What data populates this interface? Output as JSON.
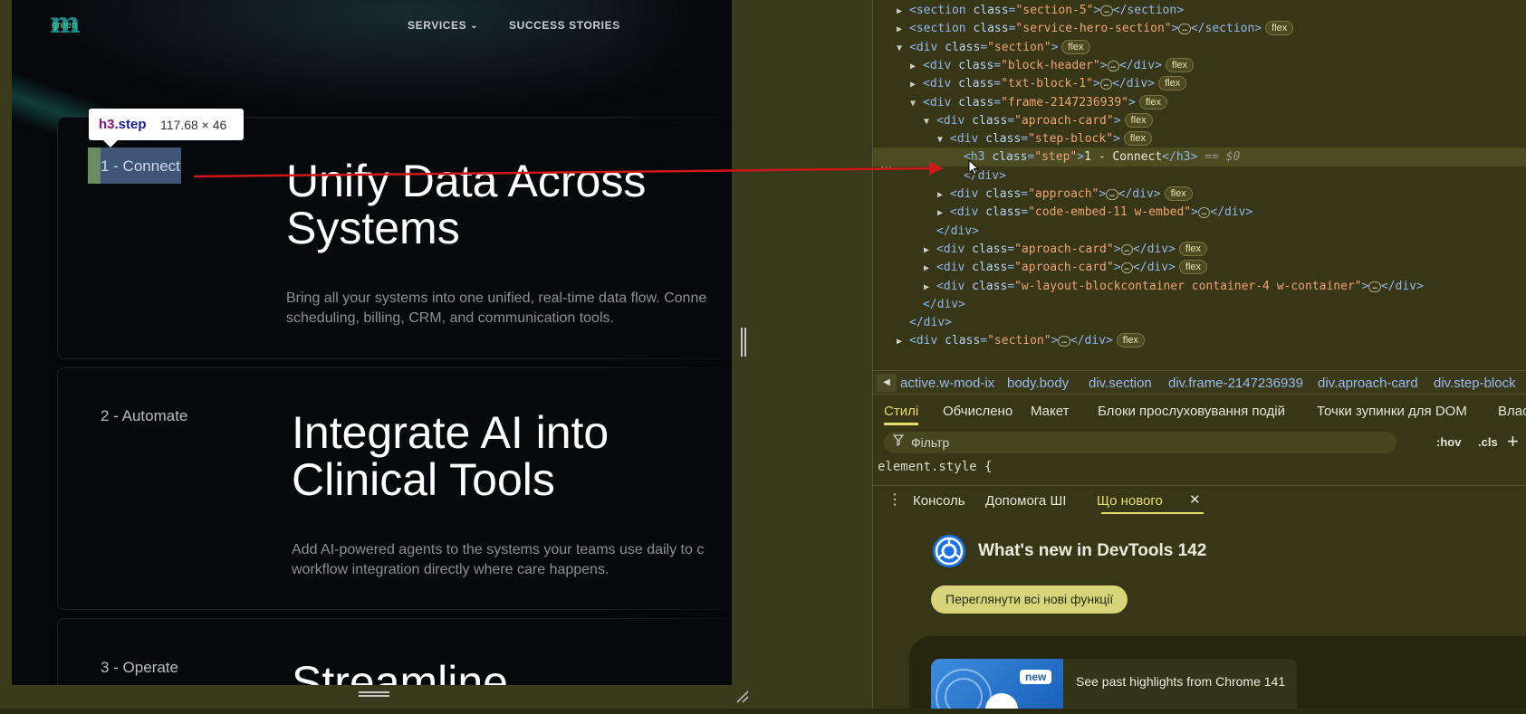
{
  "site": {
    "logo": {
      "mark": "m",
      "word": "green"
    },
    "nav": {
      "services": "SERVICES",
      "services_chevron": "⌄",
      "success": "SUCCESS STORIES"
    },
    "cards": [
      {
        "step": "1 - Connect",
        "title_lines": [
          "Unify Data Across",
          "Systems"
        ],
        "body_lines": [
          "Bring all your systems into one unified, real-time data flow. Conne",
          "scheduling, billing, CRM, and communication tools."
        ]
      },
      {
        "step": "2 - Automate",
        "title_lines": [
          "Integrate AI into",
          "Clinical Tools"
        ],
        "body_lines": [
          "Add AI-powered agents to the systems your teams use daily to c",
          "workflow integration directly where care happens."
        ]
      },
      {
        "step": "3 - Operate",
        "title_lines": [
          "Streamline"
        ]
      }
    ]
  },
  "tooltip": {
    "tag": "h3",
    "cls": ".step",
    "dims": "117.68 × 46"
  },
  "dom_tree": {
    "lines": [
      {
        "tri": "▶",
        "tag": "section",
        "cls": "section-5",
        "collapsed": true,
        "close": "</section>"
      },
      {
        "tri": "▶",
        "tag": "section",
        "cls": "service-hero-section",
        "collapsed": true,
        "close": "</section>",
        "badge": "flex"
      },
      {
        "tri": "▼",
        "tag": "div",
        "cls": "section",
        "badge": "flex"
      },
      {
        "tri": "▶",
        "tag": "div",
        "cls": "block-header",
        "collapsed": true,
        "close": "</div>",
        "badge": "flex"
      },
      {
        "tri": "▶",
        "tag": "div",
        "cls": "txt-block-1",
        "collapsed": true,
        "close": "</div>",
        "badge": "flex"
      },
      {
        "tri": "▼",
        "tag": "div",
        "cls": "frame-2147236939",
        "badge": "flex"
      },
      {
        "tri": "▼",
        "tag": "div",
        "cls": "aproach-card",
        "badge": "flex"
      },
      {
        "tri": "▼",
        "tag": "div",
        "cls": "step-block",
        "badge": "flex"
      },
      {
        "tri": "",
        "tag": "h3",
        "cls": "step",
        "text": "1 - Connect",
        "close": "</h3>",
        "eq": "== $0",
        "selected": true
      },
      {
        "tri": "",
        "closeonly": "</div>"
      },
      {
        "tri": "▶",
        "tag": "div",
        "cls": "approach",
        "collapsed": true,
        "close": "</div>",
        "badge": "flex"
      },
      {
        "tri": "▶",
        "tag": "div",
        "cls": "code-embed-11 w-embed",
        "collapsed": true,
        "close": "</div>"
      },
      {
        "tri": "",
        "closeonly": "</div>"
      },
      {
        "tri": "▶",
        "tag": "div",
        "cls": "aproach-card",
        "collapsed": true,
        "close": "</div>",
        "badge": "flex"
      },
      {
        "tri": "▶",
        "tag": "div",
        "cls": "aproach-card",
        "collapsed": true,
        "close": "</div>",
        "badge": "flex"
      },
      {
        "tri": "▶",
        "tag": "div",
        "cls": "w-layout-blockcontainer container-4 w-container",
        "collapsed": true,
        "close": "</div>"
      },
      {
        "tri": "",
        "closeonly": "</div>"
      },
      {
        "tri": "",
        "closeonly": "</div>"
      },
      {
        "tri": "▶",
        "tag": "div",
        "cls": "section",
        "collapsed": true,
        "close": "</div>",
        "badge": "flex"
      }
    ],
    "ellipsis": "…",
    "gutter_dots": "…"
  },
  "breadcrumbs": {
    "back": "◀",
    "items": [
      {
        "tag": "",
        "cls": "active.w-mod-ix"
      },
      {
        "tag": "body",
        "cls": ".body"
      },
      {
        "tag": "div",
        "cls": ".section"
      },
      {
        "tag": "div",
        "cls": ".frame-2147236939"
      },
      {
        "tag": "div",
        "cls": ".aproach-card"
      },
      {
        "tag": "div",
        "cls": ".step-block"
      }
    ]
  },
  "style_tabs": [
    "Стилі",
    "Обчислено",
    "Макет",
    "Блоки прослуховування подій",
    "Точки зупинки для DOM",
    "Влас"
  ],
  "filter": {
    "placeholder": "Фільтр",
    "hov": ":hov",
    "cls": ".cls",
    "plus": "+"
  },
  "element_style": {
    "selector": "element.style",
    "open": "{",
    "close": "}"
  },
  "drawer": {
    "menu": "⋮",
    "tabs": [
      "Консоль",
      "Допомога ШІ",
      "Що нового"
    ],
    "close": "✕"
  },
  "whats_new": {
    "title": "What's new in DevTools 142",
    "button": "Переглянути всі нові функції",
    "badge": "new",
    "item_text": "See past highlights from Chrome 141"
  },
  "colors": {
    "accent": "#e8dc6a",
    "highlight_red": "#d01818"
  }
}
